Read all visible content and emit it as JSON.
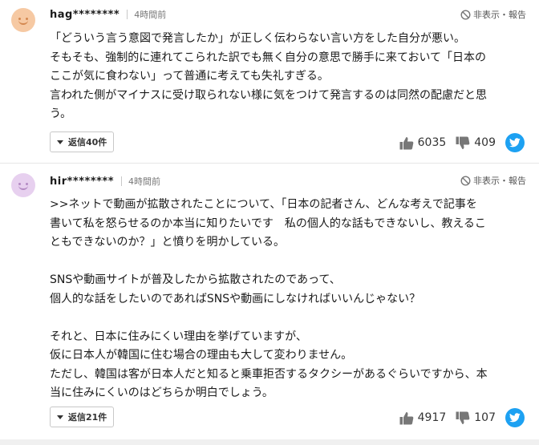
{
  "comments": [
    {
      "username": "hag********",
      "time": "4時間前",
      "report_label": "非表示・報告",
      "avatar_color": "#f6c9a3",
      "avatar_feature_color": "#d4884f",
      "body": "「どういう言う意図で発言したか」が正しく伝わらない言い方をした自分が悪い。\nそもそも、強制的に連れてこられた訳でも無く自分の意思で勝手に来ておいて「日本の\nここが気に食わない」って普通に考えても失礼すぎる。\n言われた側がマイナスに受け取られない様に気をつけて発言するのは同然の配慮だと思\nう。",
      "reply_label": "返信40件",
      "likes": "6035",
      "dislikes": "409"
    },
    {
      "username": "hir********",
      "time": "4時間前",
      "report_label": "非表示・報告",
      "avatar_color": "#e7d0ef",
      "avatar_feature_color": "#b48ac4",
      "body": ">>ネットで動画が拡散されたことについて、「日本の記者さん、どんな考えで記事を\n書いて私を怒らせるのか本当に知りたいです　私の個人的な話もできないし、教えるこ\nともできないのか？」と憤りを明かしている。\n\nSNSや動画サイトが普及したから拡散されたのであって、\n個人的な話をしたいのであればSNSや動画にしなければいいんじゃない？\n\nそれと、日本に住みにくい理由を挙げていますが、\n仮に日本人が韓国に住む場合の理由も大して変わりません。\nただし、韓国は客が日本人だと知ると乗車拒否するタクシーがあるぐらいですから、本\n当に住みにくいのはどちらか明白でしょう。",
      "reply_label": "返信21件",
      "likes": "4917",
      "dislikes": "107"
    }
  ],
  "colors": {
    "twitter": "#1da1f2",
    "separator": "#e6e6e6",
    "meta_text": "#777777"
  }
}
